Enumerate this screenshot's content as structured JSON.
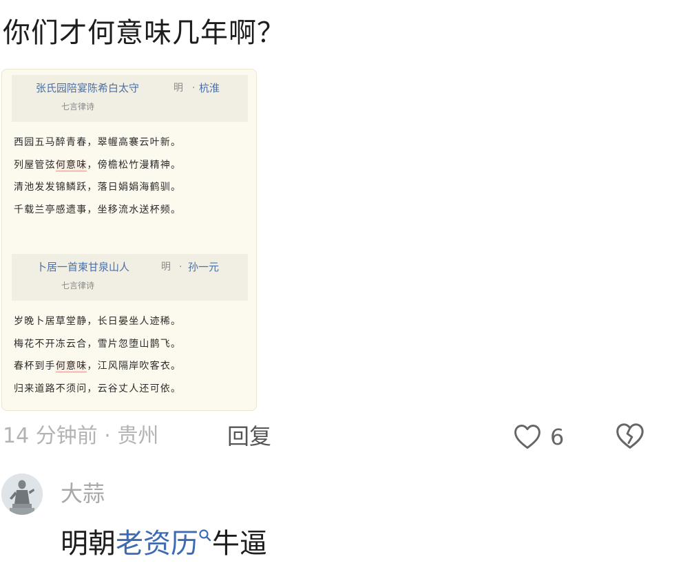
{
  "comment": {
    "text": "你们才何意味几年啊？"
  },
  "poems": [
    {
      "title": "张氏园陪宴陈希白太守",
      "dynasty": "明",
      "separator": "·",
      "author": "杭淮",
      "form": "七言律诗",
      "lines": [
        {
          "before": "西园五马醉青春，翠幄高褰云叶新。",
          "highlight": "",
          "after": ""
        },
        {
          "before": "列屋管弦",
          "highlight": "何意味",
          "after": "，傍檐松竹漫精神。"
        },
        {
          "before": "清池发发锦鳞跃，落日娟娟海鹤驯。",
          "highlight": "",
          "after": ""
        },
        {
          "before": "千载兰亭感遗事，坐移流水送杯频。",
          "highlight": "",
          "after": ""
        }
      ]
    },
    {
      "title": "卜居一首柬甘泉山人",
      "dynasty": "明",
      "separator": "·",
      "author": "孙一元",
      "form": "七言律诗",
      "lines": [
        {
          "before": "岁晚卜居草堂静，长日晏坐人迹稀。",
          "highlight": "",
          "after": ""
        },
        {
          "before": "梅花不开冻云合，雪片忽堕山鹊飞。",
          "highlight": "",
          "after": ""
        },
        {
          "before": "春杯到手",
          "highlight": "何意味",
          "after": "，江风隔岸吹客衣。"
        },
        {
          "before": "归来道路不须问，云谷丈人还可依。",
          "highlight": "",
          "after": ""
        }
      ]
    }
  ],
  "meta": {
    "time_location": "14 分钟前 · 贵州",
    "reply_label": "回复",
    "like_icon": "heart-outline-icon",
    "like_count": "6",
    "dislike_icon": "broken-heart-icon"
  },
  "reply": {
    "user": "大蒜",
    "avatar": "statue-avatar",
    "text_before": "明朝",
    "link_text": "老资历",
    "link_icon": "search-mark-icon",
    "text_after": "牛逼"
  },
  "colors": {
    "link": "#3d6bb3",
    "poem_title": "#4a6fa5",
    "card_bg": "#fcf9ee",
    "highlight_underline": "#e39a8c",
    "muted": "#b3b3b3"
  }
}
